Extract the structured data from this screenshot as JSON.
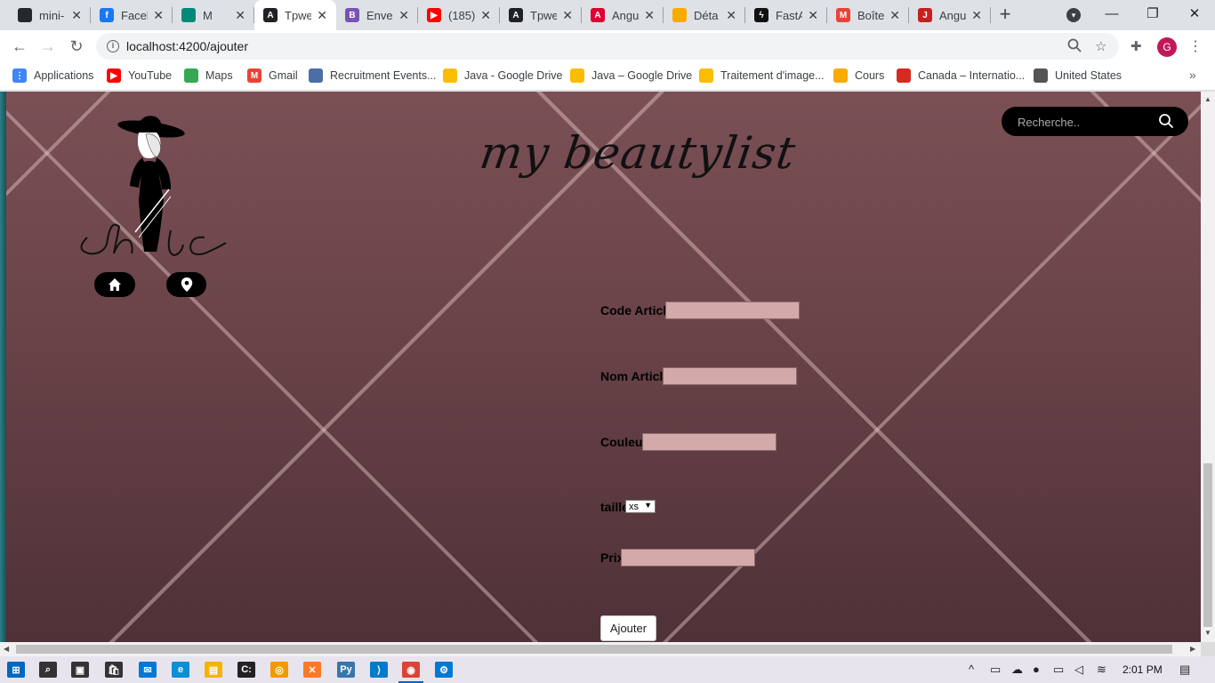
{
  "browser": {
    "tabs": [
      {
        "title": "mini-",
        "icon": "github-icon",
        "color": "#24292e",
        "glyph": "",
        "active": false
      },
      {
        "title": "Faceb",
        "icon": "facebook-icon",
        "color": "#1877f2",
        "glyph": "f",
        "active": false
      },
      {
        "title": "M",
        "icon": "google-meet-icon",
        "color": "#00897b",
        "glyph": "",
        "active": false
      },
      {
        "title": "Tpwe",
        "icon": "angular-icon",
        "color": "#202124",
        "glyph": "A",
        "active": true
      },
      {
        "title": "Envel",
        "icon": "bootstrap-icon",
        "color": "#7952b3",
        "glyph": "B",
        "active": false
      },
      {
        "title": "(185)",
        "icon": "youtube-icon",
        "color": "#ff0000",
        "glyph": "▶",
        "active": false
      },
      {
        "title": "Tpwe",
        "icon": "angular-icon",
        "color": "#202124",
        "glyph": "A",
        "active": false
      },
      {
        "title": "Angu",
        "icon": "angular-icon",
        "color": "#dd0031",
        "glyph": "A",
        "active": false
      },
      {
        "title": "Déta",
        "icon": "classroom-icon",
        "color": "#f9ab00",
        "glyph": "",
        "active": false
      },
      {
        "title": "FastA",
        "icon": "fastapi-icon",
        "color": "#111",
        "glyph": "ϟ",
        "active": false
      },
      {
        "title": "Boîte",
        "icon": "gmail-icon",
        "color": "#ea4335",
        "glyph": "M",
        "active": false
      },
      {
        "title": "Angu",
        "icon": "pdf-icon",
        "color": "#c5221f",
        "glyph": "J",
        "active": false
      }
    ],
    "url": "localhost:4200/ajouter",
    "profile_initial": "G",
    "bookmarks": [
      {
        "label": "Applications",
        "icon": "apps-grid-icon",
        "color": "#4285f4",
        "glyph": "⋮"
      },
      {
        "label": "YouTube",
        "icon": "youtube-icon",
        "color": "#ff0000",
        "glyph": "▶"
      },
      {
        "label": "Maps",
        "icon": "maps-icon",
        "color": "#34a853",
        "glyph": ""
      },
      {
        "label": "Gmail",
        "icon": "gmail-icon",
        "color": "#ea4335",
        "glyph": "M"
      },
      {
        "label": "Recruitment Events...",
        "icon": "globe-icon",
        "color": "#4a6fa5",
        "glyph": ""
      },
      {
        "label": "Java - Google Drive",
        "icon": "google-drive-icon",
        "color": "#fbbc04",
        "glyph": ""
      },
      {
        "label": "Java – Google Drive",
        "icon": "google-drive-icon",
        "color": "#fbbc04",
        "glyph": ""
      },
      {
        "label": "Traitement d'image...",
        "icon": "google-drive-icon",
        "color": "#fbbc04",
        "glyph": ""
      },
      {
        "label": "Cours",
        "icon": "classroom-icon",
        "color": "#f9ab00",
        "glyph": ""
      },
      {
        "label": "Canada – Internatio...",
        "icon": "canada-icon",
        "color": "#d52b1e",
        "glyph": ""
      },
      {
        "label": "United States",
        "icon": "seal-icon",
        "color": "#555",
        "glyph": ""
      }
    ]
  },
  "page": {
    "brand_title": "my beautylist",
    "search_placeholder": "Recherche..",
    "form": {
      "code_label": "Code Article",
      "code_value": "",
      "nom_label": "Nom Article",
      "nom_value": "",
      "couleur_label": "Couleur",
      "couleur_value": "",
      "taille_label": "taille",
      "taille_selected": "xs",
      "prix_label": "Prix",
      "prix_value": "",
      "submit_label": "Ajouter"
    }
  },
  "taskbar": {
    "apps": [
      {
        "icon": "windows-start-icon",
        "color": "#0067c0",
        "glyph": "⊞"
      },
      {
        "icon": "search-icon",
        "color": "#333",
        "glyph": "⌕"
      },
      {
        "icon": "task-view-icon",
        "color": "#333",
        "glyph": "▣"
      },
      {
        "icon": "store-icon",
        "color": "#333",
        "glyph": "🛍"
      },
      {
        "icon": "mail-icon",
        "color": "#0078d4",
        "glyph": "✉"
      },
      {
        "icon": "edge-icon",
        "color": "#0c8fd6",
        "glyph": "e"
      },
      {
        "icon": "file-explorer-icon",
        "color": "#f4b400",
        "glyph": "▤"
      },
      {
        "icon": "terminal-icon",
        "color": "#222",
        "glyph": "C:"
      },
      {
        "icon": "chromium-app-icon",
        "color": "#f29900",
        "glyph": "◎"
      },
      {
        "icon": "xampp-icon",
        "color": "#fb7a24",
        "glyph": "✕"
      },
      {
        "icon": "python-icon",
        "color": "#3776ab",
        "glyph": "Py"
      },
      {
        "icon": "vscode-icon",
        "color": "#007acc",
        "glyph": "⟩"
      },
      {
        "icon": "chrome-icon",
        "color": "#db4437",
        "glyph": "◉"
      },
      {
        "icon": "settings-app-icon",
        "color": "#0078d4",
        "glyph": "⚙"
      }
    ],
    "clock": "2:01 PM"
  }
}
